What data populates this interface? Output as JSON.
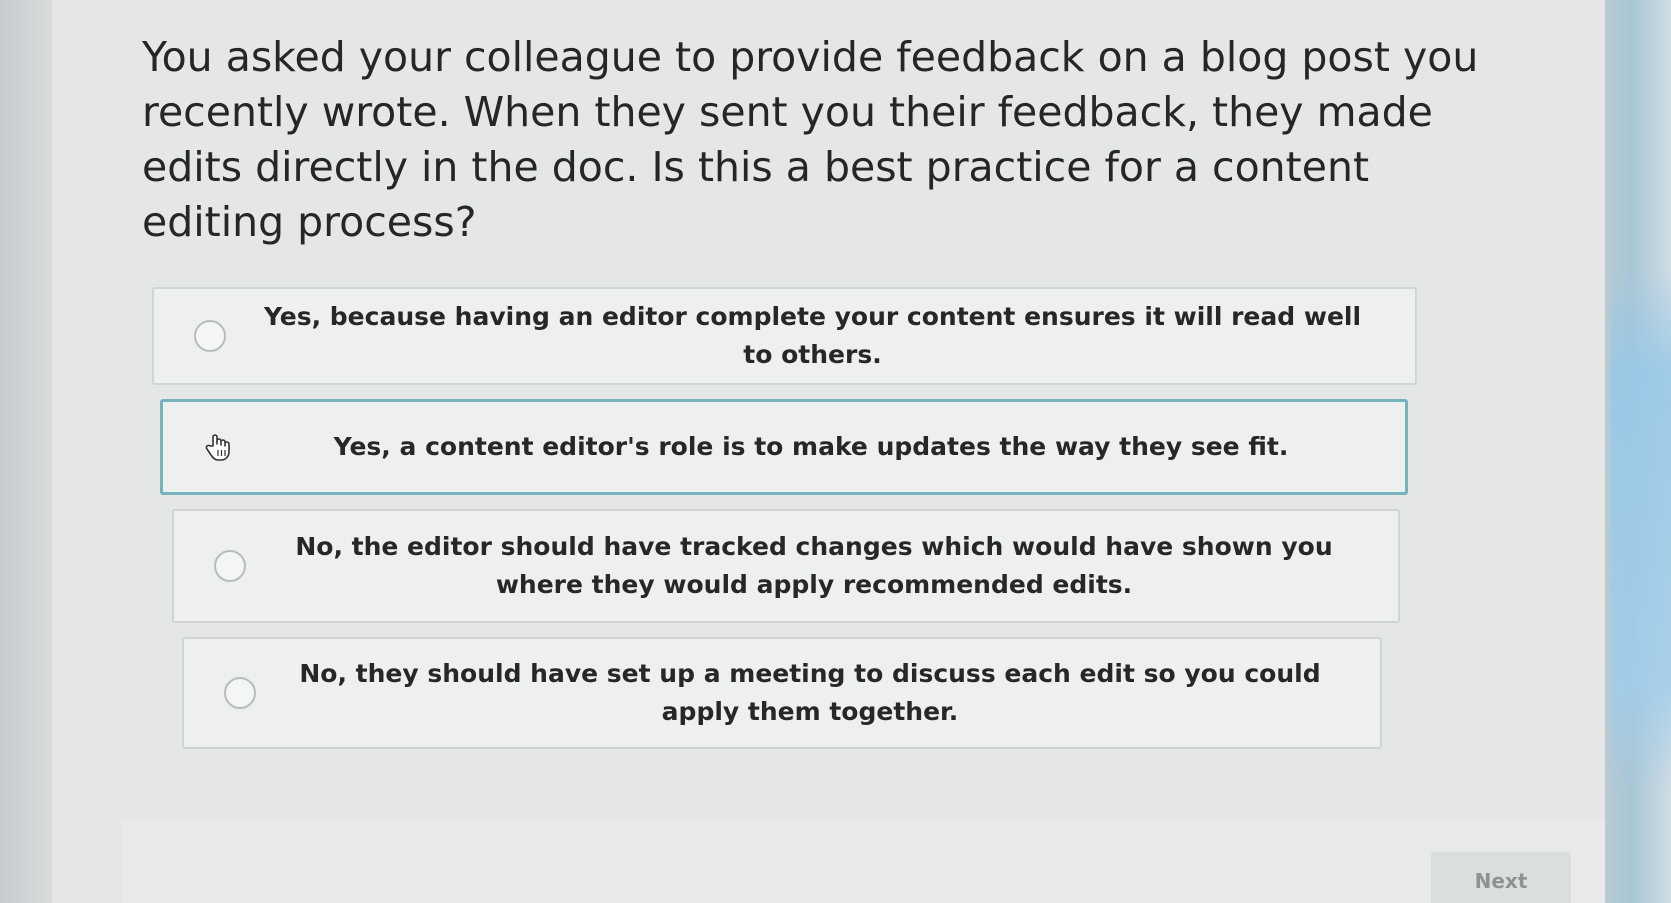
{
  "question": {
    "text": "You asked your colleague to provide feedback on a blog post you recently wrote. When they sent you their feedback, they made edits directly in the doc. Is this a best practice for a content editing process?"
  },
  "options": [
    {
      "label": "Yes, because having an editor complete your content ensures it will read well to others.",
      "icon": "radio-icon"
    },
    {
      "label": "Yes, a content editor's role is to make updates the way they see fit.",
      "icon": "hand-cursor-icon"
    },
    {
      "label": "No, the editor should have tracked changes which would have shown you where they would apply recommended edits.",
      "icon": "radio-icon"
    },
    {
      "label": "No, they should have set up a meeting to discuss each edit so you could apply them together.",
      "icon": "radio-icon"
    }
  ],
  "footer": {
    "next_label": "Next"
  },
  "colors": {
    "hover_border": "#76b3bd",
    "text": "#272727"
  }
}
